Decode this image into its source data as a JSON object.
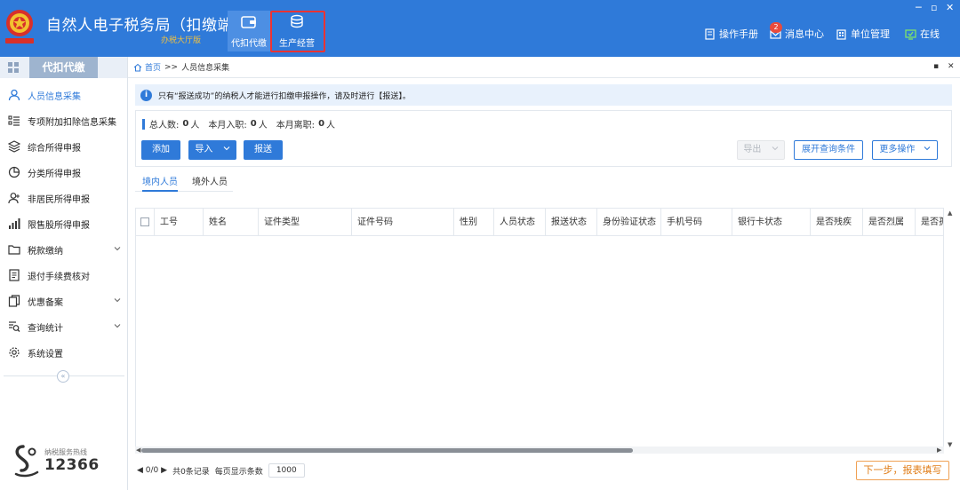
{
  "header": {
    "title": "自然人电子税务局（扣缴端）",
    "subtitle": "办税大厅版",
    "tabs": [
      {
        "label": "代扣代缴",
        "icon": "wallet-icon"
      },
      {
        "label": "生产经营",
        "icon": "coins-icon"
      }
    ],
    "right": {
      "manual": "操作手册",
      "messages": "消息中心",
      "message_count": "2",
      "unit": "单位管理",
      "status": "在线"
    },
    "window_controls": [
      "─",
      "▫",
      "✕"
    ]
  },
  "sidebar": {
    "section": "代扣代缴",
    "items": [
      {
        "label": "人员信息采集",
        "icon": "person-icon",
        "active": true
      },
      {
        "label": "专项附加扣除信息采集",
        "icon": "list-icon"
      },
      {
        "label": "综合所得申报",
        "icon": "layers-icon"
      },
      {
        "label": "分类所得申报",
        "icon": "pie-icon"
      },
      {
        "label": "非居民所得申报",
        "icon": "person-plus-icon"
      },
      {
        "label": "限售股所得申报",
        "icon": "bar-chart-icon"
      },
      {
        "label": "税款缴纳",
        "icon": "folder-icon",
        "expandable": true
      },
      {
        "label": "退付手续费核对",
        "icon": "doc-icon"
      },
      {
        "label": "优惠备案",
        "icon": "copy-icon",
        "expandable": true
      },
      {
        "label": "查询统计",
        "icon": "search-list-icon",
        "expandable": true
      },
      {
        "label": "系统设置",
        "icon": "gear-icon"
      }
    ],
    "collapse": "«",
    "hotline_label": "纳税服务热线",
    "hotline_number": "12366"
  },
  "breadcrumb": {
    "home": "首页",
    "sep": ">>",
    "current": "人员信息采集"
  },
  "notice": {
    "text": "只有“报送成功”的纳税人才能进行扣缴申报操作，请及时进行【报送】。"
  },
  "stats": {
    "total_label": "总人数:",
    "total": "0",
    "joined_label": "本月入职:",
    "joined": "0",
    "left_label": "本月离职:",
    "left": "0",
    "unit": "人"
  },
  "toolbar": {
    "add": "添加",
    "import": "导入",
    "submit": "报送",
    "export": "导出",
    "expand_query": "展开查询条件",
    "more": "更多操作"
  },
  "person_tabs": [
    "境内人员",
    "境外人员"
  ],
  "table": {
    "columns": [
      "工号",
      "姓名",
      "证件类型",
      "证件号码",
      "性别",
      "人员状态",
      "报送状态",
      "身份验证状态",
      "手机号码",
      "银行卡状态",
      "是否残疾",
      "是否烈属",
      "是否孤老"
    ],
    "rows": []
  },
  "pager": {
    "nav": "◀ 0/0 ▶",
    "records": "共0条记录",
    "page_size_label": "每页显示条数",
    "page_size": "1000"
  },
  "next_button": "下一步，报表填写",
  "colors": {
    "brand": "#2f7ad9",
    "highlight_box": "#e33333",
    "next_accent": "#e07d18"
  }
}
